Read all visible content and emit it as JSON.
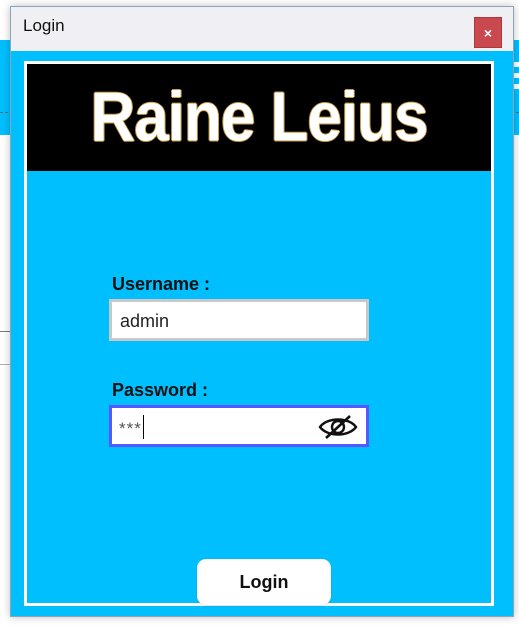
{
  "window": {
    "title": "Login",
    "close_symbol": "×"
  },
  "banner": {
    "text": "Raine Leius"
  },
  "form": {
    "username_label": "Username :",
    "username_value": "admin",
    "password_label": "Password :",
    "password_masked": "***",
    "login_label": "Login"
  },
  "colors": {
    "background": "#00bfff",
    "banner": "#000000",
    "focus_border": "#5a56ff",
    "close_button": "#c9494f"
  },
  "icons": {
    "password_toggle": "eye-slash-icon"
  }
}
